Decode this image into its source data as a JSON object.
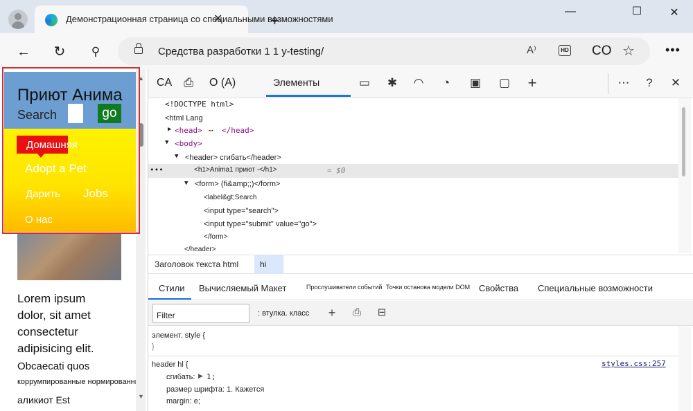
{
  "browser": {
    "tab_title": "Демонстрационная страница со специальными возможностями",
    "address": "Средства разработки 1 1 y-testing/",
    "read_aloud_label": "A⁾",
    "hd_label": "HD",
    "co_label": "CO"
  },
  "webpage": {
    "title": "Приют Анима",
    "search_label": "Search",
    "go_label": "go",
    "nav": {
      "home": "Домашняя",
      "adopt": "Adopt a Pet",
      "donate": "Дарить",
      "jobs": "Jobs",
      "about": "О нас"
    },
    "lorem_lines": [
      "Lorem ipsum",
      "dolor, sit amet",
      "consectetur",
      "adipisicing elit."
    ],
    "obc": "Obcaecati quos",
    "korr": "коррумпированные нормированные",
    "alik": "аликиот Est"
  },
  "devtools": {
    "toolbar": {
      "ca_label": "CA",
      "o_label": "O (A)",
      "elements_label": "Элементы"
    },
    "dom": {
      "doctype": "<!DOCTYPE html>",
      "html_open": "<html Lang",
      "head": "<head>",
      "head_close": "</head>",
      "body": "<body>",
      "header": "<header> сгибать</header>",
      "h1": "<h1>Anima1 приют -</h1>",
      "h1_eq": "= $0",
      "form": "<form> (fi&amp;;)</form>",
      "label": "<label&gt;Search",
      "input_search": "<input type=\"search\">",
      "input_submit": "<input type=\"submit\" value=\"go\">",
      "form_close": "</form>",
      "header_close": "</header>"
    },
    "breadcrumbs": [
      "Заголовок текста html",
      "hi"
    ],
    "pane_tabs": {
      "styles": "Стили",
      "computed": "Вычисляемый Макет",
      "listeners": "Прослушиватели событий",
      "dom_breakpoints": "Точки останова модели DOM",
      "properties": "Свойства",
      "accessibility": "Специальные возможности"
    },
    "filter_placeholder": "Filter",
    "hov_cls": ": втулка. класс",
    "styles": {
      "element_style": "элемент. style {",
      "element_style_close": "}",
      "rule_selector": "header hl {",
      "rule_link": "styles.css:257",
      "prop1": "сгибать:",
      "prop1_val": "1;",
      "prop2": "размер шрифта: 1. Кажется",
      "prop3": "margin: е;"
    }
  }
}
